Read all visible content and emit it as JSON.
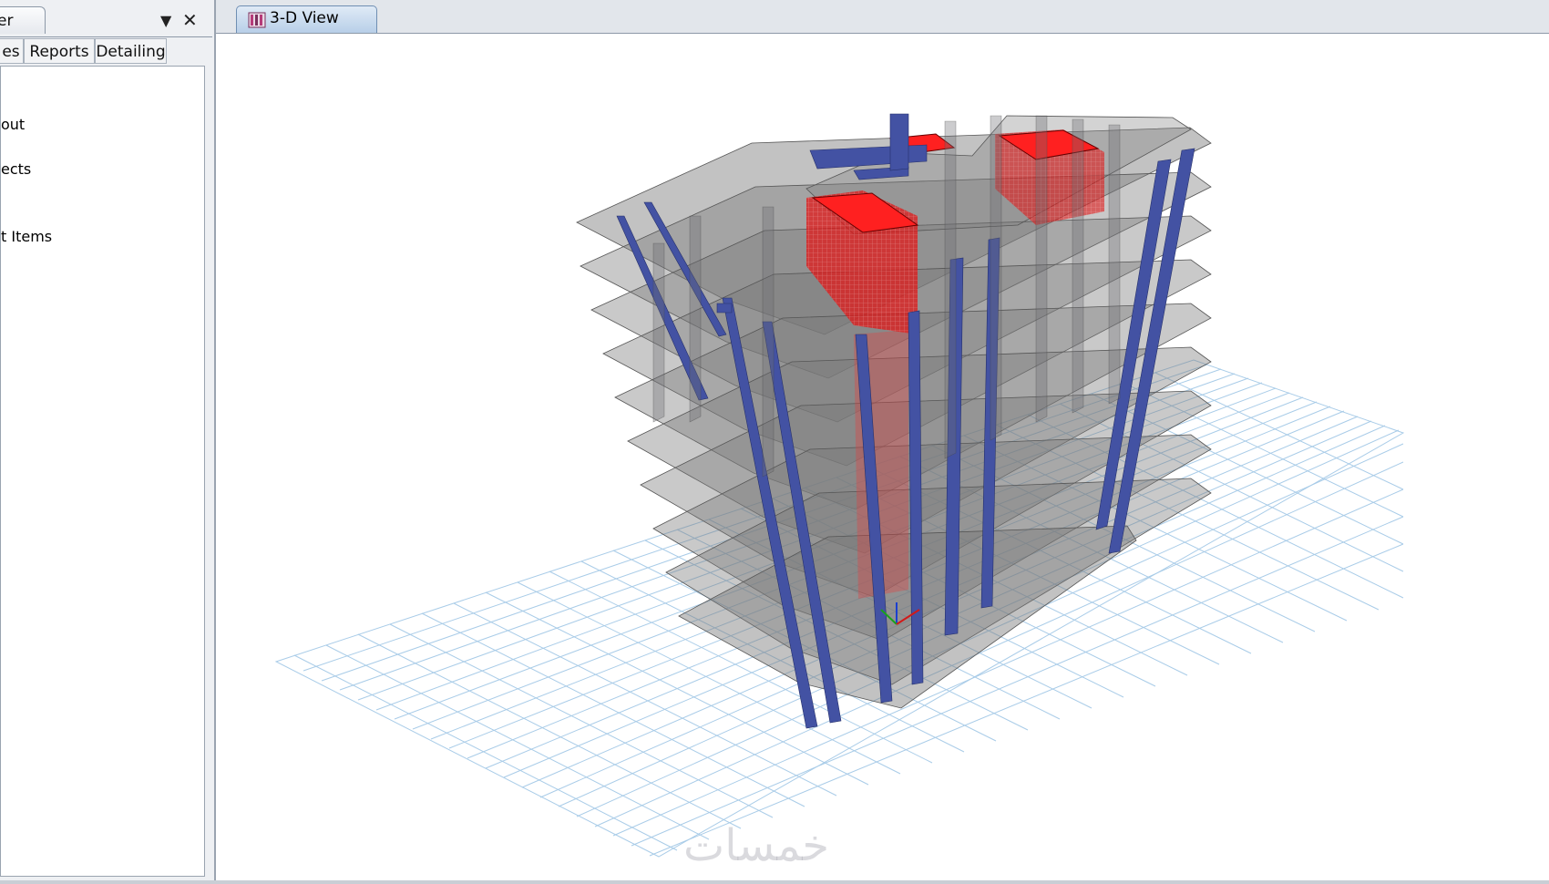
{
  "explorer": {
    "title": "er",
    "tabs": [
      "es",
      "Reports",
      "Detailing"
    ],
    "items": [
      "out",
      "ects",
      "t Items"
    ]
  },
  "document": {
    "tab_label": "3-D View"
  },
  "watermark": "خمسات",
  "colors": {
    "beam": "#3f4fa0",
    "slab": "#8c8c8c",
    "wall": "#e01010",
    "grid": "#a9cce8"
  }
}
